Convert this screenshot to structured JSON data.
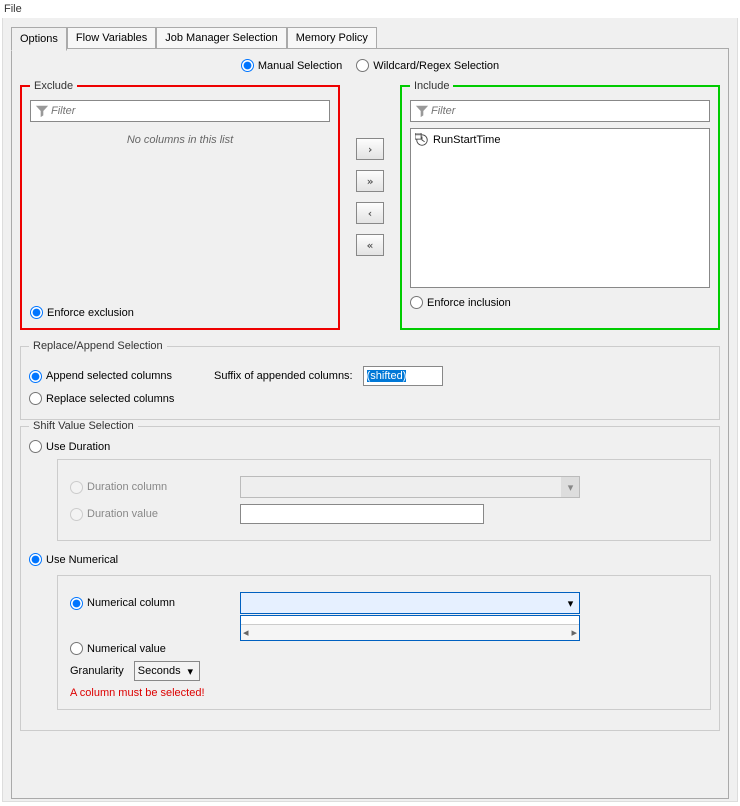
{
  "menu": {
    "file": "File"
  },
  "tabs": [
    "Options",
    "Flow Variables",
    "Job Manager Selection",
    "Memory Policy"
  ],
  "selectionMode": {
    "manual": "Manual Selection",
    "wildcard": "Wildcard/Regex Selection"
  },
  "exclude": {
    "legend": "Exclude",
    "filterPlaceholder": "Filter",
    "emptyText": "No columns in this list",
    "enforce": "Enforce exclusion"
  },
  "include": {
    "legend": "Include",
    "filterPlaceholder": "Filter",
    "items": [
      "RunStartTime"
    ],
    "enforce": "Enforce inclusion"
  },
  "moveButtons": {
    "right": "›",
    "allRight": "»",
    "left": "‹",
    "allLeft": "«"
  },
  "replaceAppend": {
    "legend": "Replace/Append Selection",
    "append": "Append selected columns",
    "replace": "Replace selected columns",
    "suffixLabel": "Suffix of appended columns:",
    "suffixValue": "(shifted)"
  },
  "shift": {
    "legend": "Shift Value Selection",
    "useDuration": "Use Duration",
    "durationColumn": "Duration column",
    "durationValue": "Duration value",
    "useNumerical": "Use Numerical",
    "numericalColumn": "Numerical column",
    "numericalValue": "Numerical value",
    "granularityLabel": "Granularity",
    "granularityValue": "Seconds",
    "error": "A column must be selected!"
  }
}
